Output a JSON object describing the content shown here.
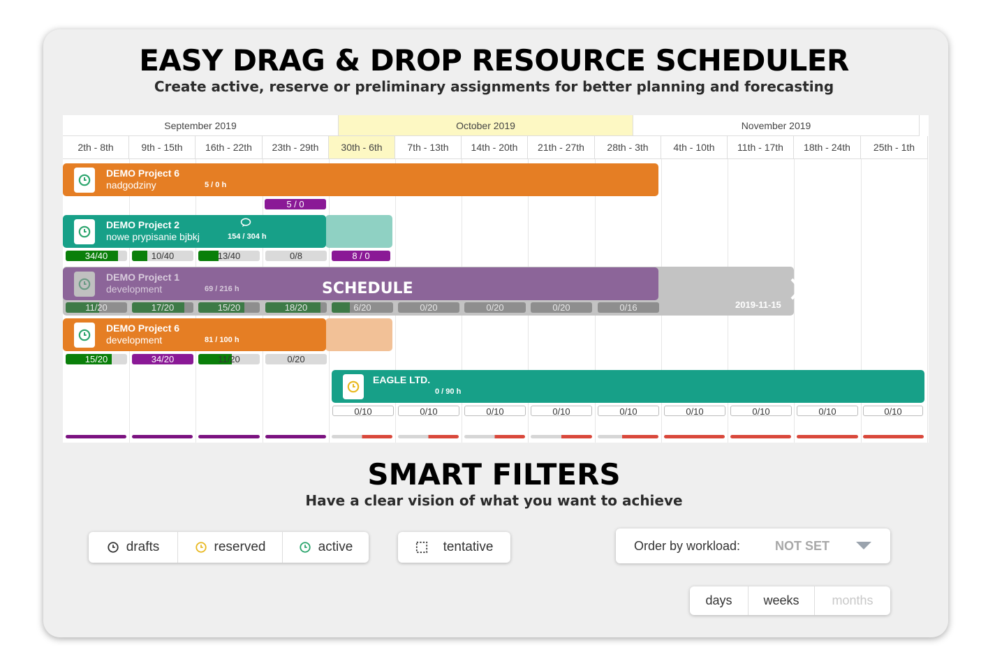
{
  "header": {
    "title": "EASY DRAG & DROP RESOURCE SCHEDULER",
    "subtitle": "Create active, reserve or preliminary assignments for better planning and forecasting"
  },
  "gantt": {
    "months": [
      {
        "label": "September 2019",
        "highlight": false
      },
      {
        "label": "October 2019",
        "highlight": true
      },
      {
        "label": "November 2019",
        "highlight": false
      }
    ],
    "weeks": [
      "2th - 8th",
      "9th - 15th",
      "16th - 22th",
      "23th - 29th",
      "30th - 6th",
      "7th - 13th",
      "14th - 20th",
      "21th - 27th",
      "28th - 3th",
      "4th - 10th",
      "11th - 17th",
      "18th - 24th",
      "25th - 1th"
    ],
    "highlight_week_index": 4,
    "assignments": [
      {
        "name": "DEMO Project 6",
        "task": "nadgodziny",
        "hours": "5 / 0 h",
        "color": "#e57e24"
      },
      {
        "name": "DEMO Project 2",
        "task": "nowe prypisanie bjbkj",
        "hours": "154 / 304 h",
        "color": "#17a088",
        "ghost_color": "#8fd1c3"
      },
      {
        "name": "DEMO Project 1",
        "task": "development",
        "hours": "69 / 216 h",
        "color": "#8c6599"
      },
      {
        "name": "DEMO Project 6",
        "task": "development",
        "hours": "81 / 100 h",
        "color": "#e57e24",
        "ghost_color": "#f2c197"
      },
      {
        "name": "EAGLE LTD.",
        "task": "",
        "hours": "0 / 90 h",
        "color": "#17a088"
      }
    ],
    "extra_pill": "5 / 0",
    "row_p2_pills": [
      "34/40",
      "10/40",
      "13/40",
      "0/8",
      "8 / 0"
    ],
    "row_p1_pills": [
      "11/20",
      "17/20",
      "15/20",
      "18/20",
      "6/20",
      "0/20",
      "0/20",
      "0/20",
      "0/16"
    ],
    "row_p6b_pills": [
      "15/20",
      "34/20",
      "11/20",
      "0/20"
    ],
    "row_eagle_pills": [
      "0/10",
      "0/10",
      "0/10",
      "0/10",
      "0/10",
      "0/10",
      "0/10",
      "0/10",
      "0/10"
    ],
    "drag_overlay": {
      "label": "SCHEDULE",
      "end_date": "2019-11-15"
    },
    "colors": {
      "purple": "#7b1280",
      "red": "#d9483b",
      "green": "#0a7f0a"
    }
  },
  "filters_section": {
    "title": "SMART FILTERS",
    "subtitle": "Have a clear vision of what you want to achieve",
    "status_filters": [
      {
        "label": "drafts",
        "icon": "clock-icon",
        "color": "#333333"
      },
      {
        "label": "reserved",
        "icon": "clock-icon",
        "color": "#e8b820"
      },
      {
        "label": "active",
        "icon": "clock-icon",
        "color": "#2aa46c"
      }
    ],
    "tentative": {
      "label": "tentative",
      "icon": "dashed-square-icon"
    },
    "order": {
      "label": "Order by workload:",
      "value": "NOT SET"
    },
    "views": [
      {
        "label": "days",
        "enabled": true
      },
      {
        "label": "weeks",
        "enabled": true
      },
      {
        "label": "months",
        "enabled": false
      }
    ]
  }
}
